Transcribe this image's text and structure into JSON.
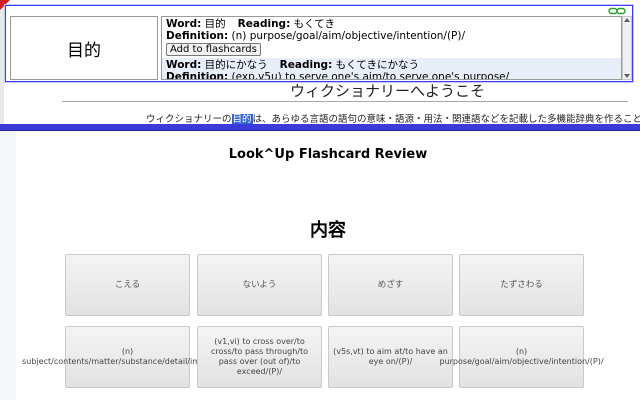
{
  "webpage": {
    "title": "ウィクショナリーへようこそ",
    "intro_before": "ウィクショナリーの",
    "intro_highlight": "目的",
    "intro_after": "は、あらゆる言語の語句の意味・語源・用法・関連語などを記載した多機能辞典を作ることです"
  },
  "popup": {
    "word": "目的",
    "entries": [
      {
        "word_label": "Word:",
        "word": "目的",
        "reading_label": "Reading:",
        "reading": "もくてき",
        "definition_label": "Definition:",
        "definition": "(n) purpose/goal/aim/objective/intention/(P)/",
        "add_button": "Add to flashcards"
      },
      {
        "word_label": "Word:",
        "word": "目的にかなう",
        "reading_label": "Reading:",
        "reading": "もくてきにかなう",
        "definition_label": "Definition:",
        "definition": "(exp,v5u) to serve one's aim/to serve one's purpose/"
      }
    ]
  },
  "review": {
    "title": "Look^Up Flashcard Review",
    "heading": "内容",
    "readings": [
      "こえる",
      "ないよう",
      "めざす",
      "たずさわる"
    ],
    "definitions": [
      "(n) subject/contents/matter/substance/detail/import/(P)/",
      "(v1,vi) to cross over/to cross/to pass through/to pass over (out of)/to exceed/(P)/",
      "(v5s,vt) to aim at/to have an eye on/(P)/",
      "(n) purpose/goal/aim/objective/intention/(P)/"
    ]
  },
  "colors": {
    "popup_border": "#3b3bff",
    "divider": "#3b3bd9",
    "highlight": "#3366cc"
  }
}
